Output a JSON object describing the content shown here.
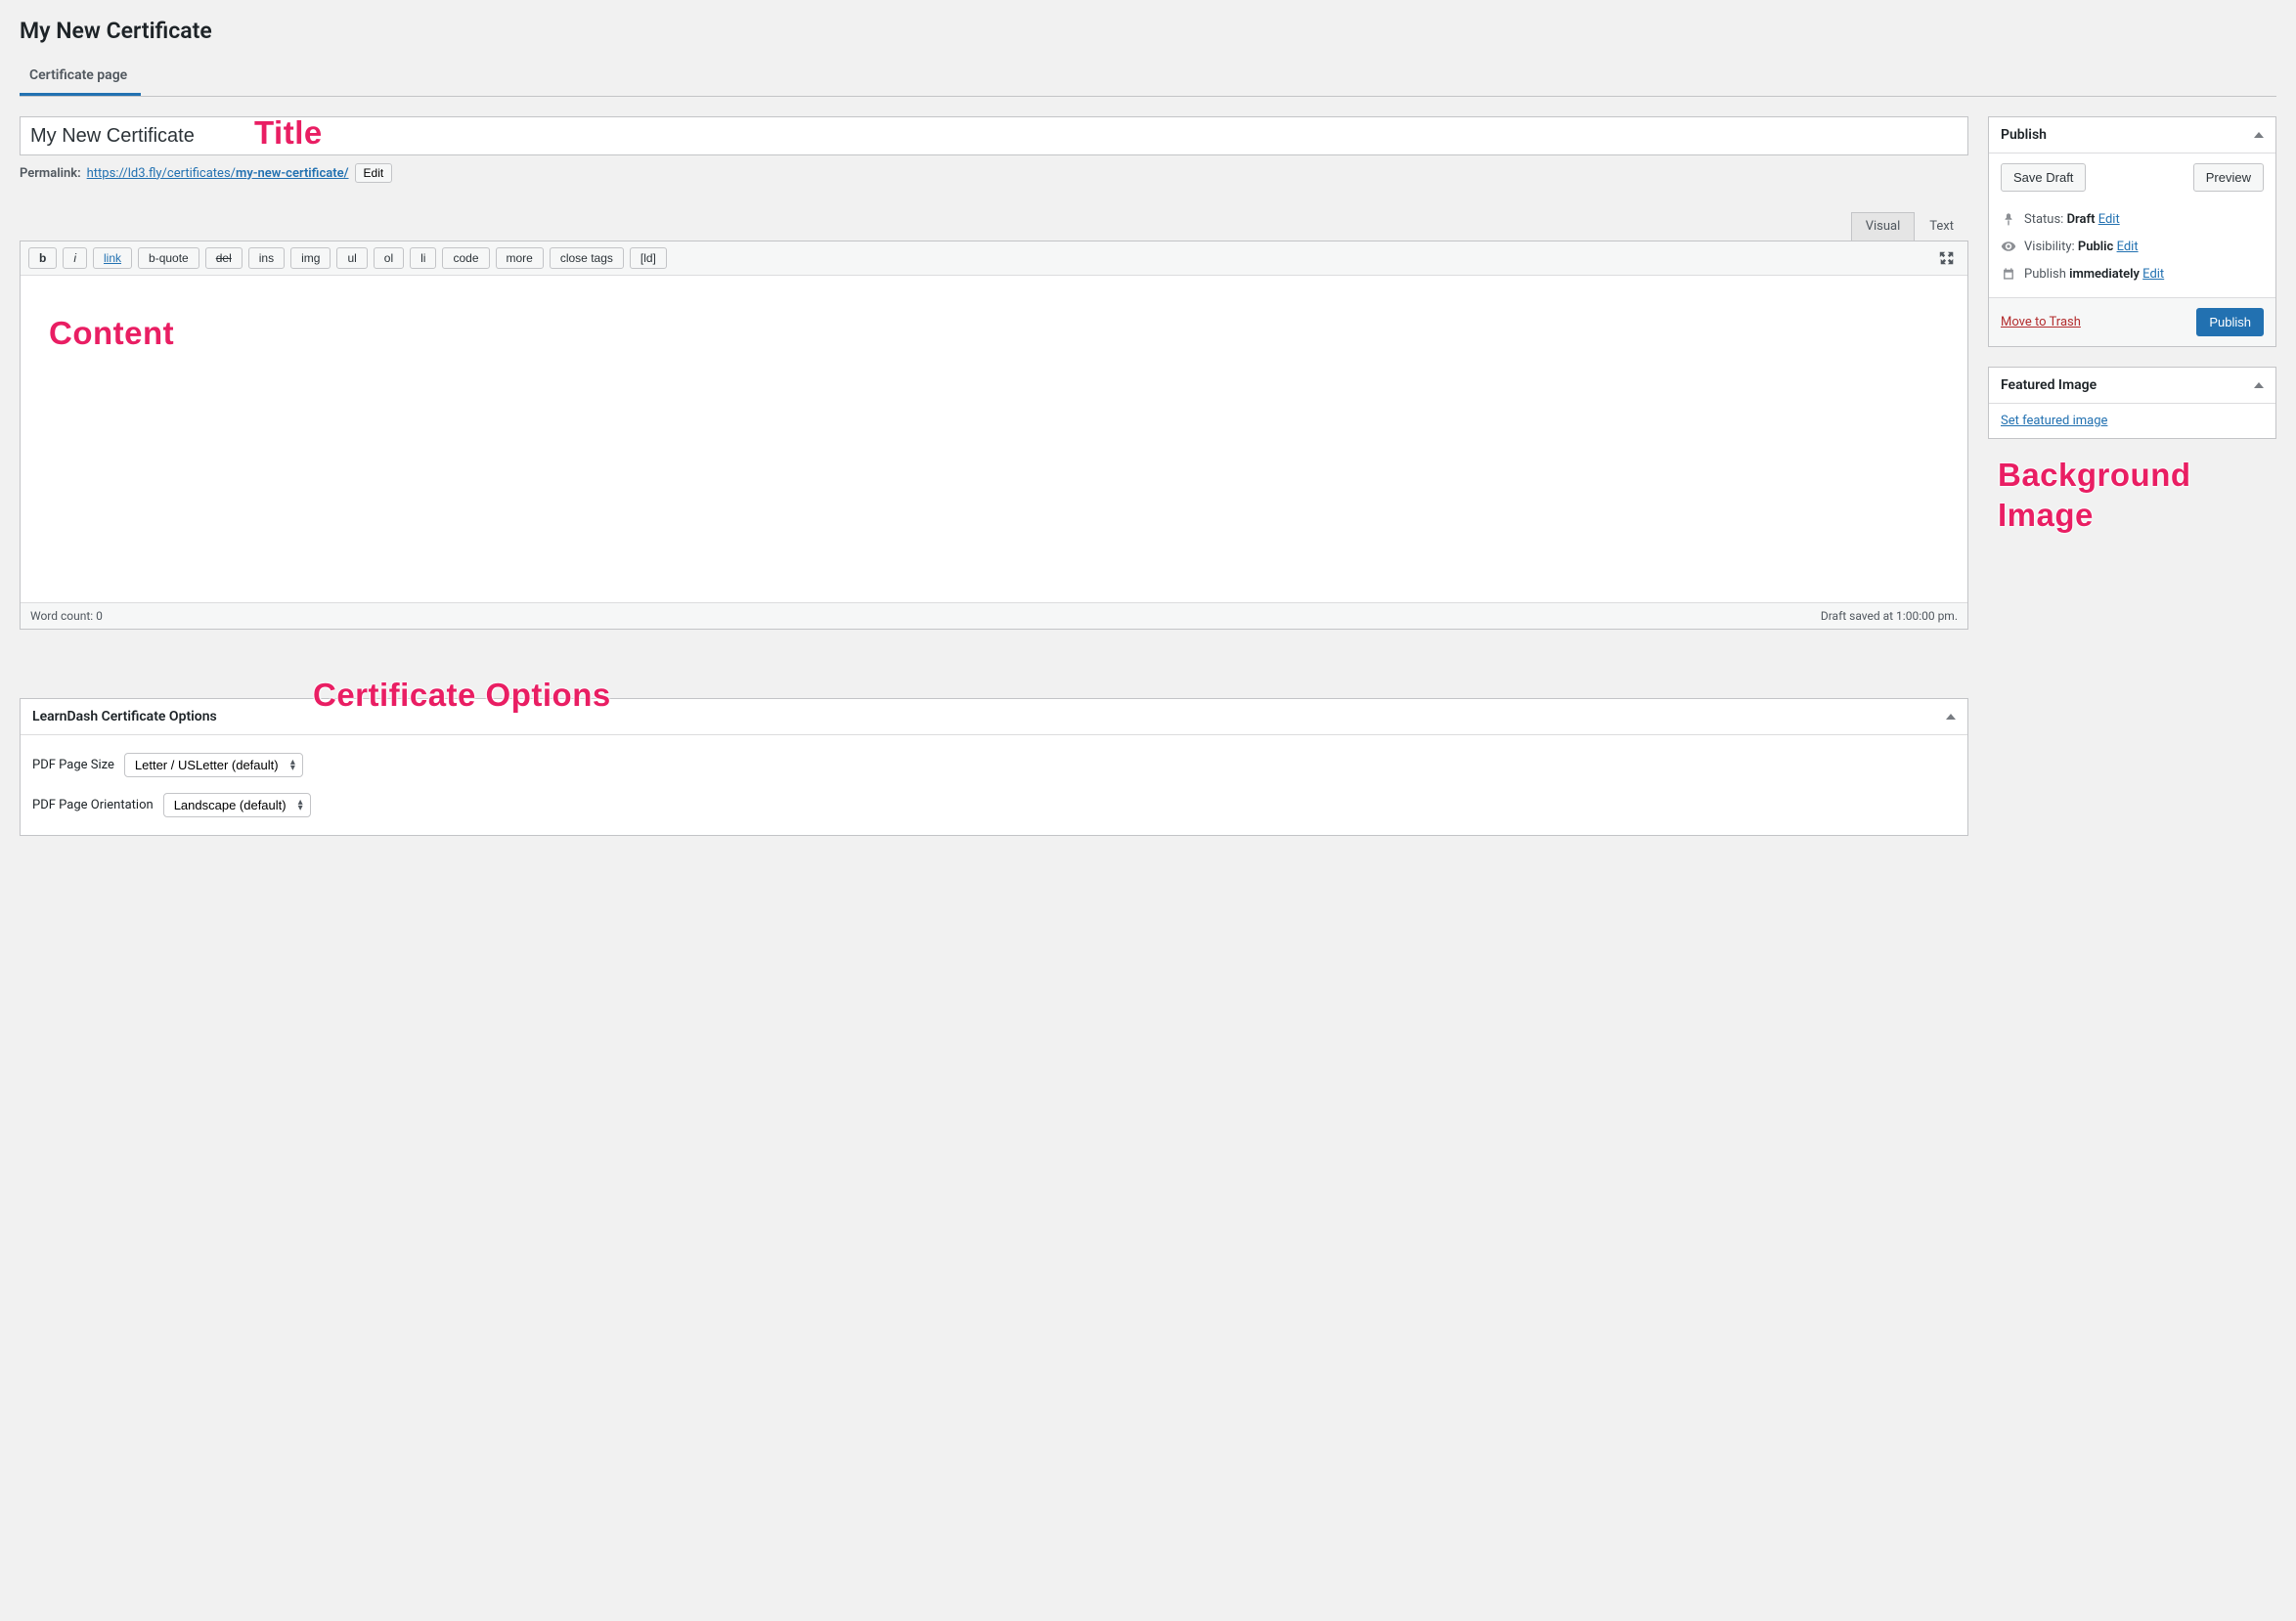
{
  "page": {
    "heading": "My New Certificate",
    "tab": "Certificate page"
  },
  "title": {
    "value": "My New Certificate"
  },
  "permalink": {
    "label": "Permalink:",
    "base": "https://ld3.fly/certificates/",
    "slug": "my-new-certificate/",
    "edit": "Edit"
  },
  "editor": {
    "tab_visual": "Visual",
    "tab_text": "Text",
    "buttons": {
      "b": "b",
      "i": "i",
      "link": "link",
      "bquote": "b-quote",
      "del": "del",
      "ins": "ins",
      "img": "img",
      "ul": "ul",
      "ol": "ol",
      "li": "li",
      "code": "code",
      "more": "more",
      "close": "close tags",
      "ld": "[ld]"
    },
    "word_count": "Word count: 0",
    "saved": "Draft saved at 1:00:00 pm."
  },
  "annotations": {
    "title": "Title",
    "content": "Content",
    "cert_options": "Certificate Options",
    "bg_image": "Background\nImage"
  },
  "publish": {
    "title": "Publish",
    "save_draft": "Save Draft",
    "preview": "Preview",
    "status_label": "Status:",
    "status_value": "Draft",
    "visibility_label": "Visibility:",
    "visibility_value": "Public",
    "schedule_label": "Publish",
    "schedule_value": "immediately",
    "edit": "Edit",
    "trash": "Move to Trash",
    "publish_btn": "Publish"
  },
  "featured": {
    "title": "Featured Image",
    "link": "Set featured image"
  },
  "cert_options": {
    "title": "LearnDash Certificate Options",
    "page_size_label": "PDF Page Size",
    "page_size_value": "Letter / USLetter (default)",
    "orientation_label": "PDF Page Orientation",
    "orientation_value": "Landscape (default)"
  }
}
